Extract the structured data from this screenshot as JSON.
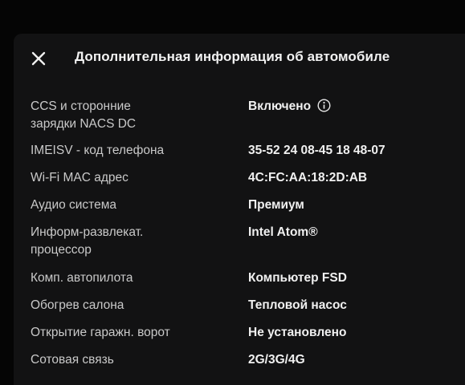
{
  "header": {
    "title": "Дополнительная информация об автомобиле",
    "close_icon": "close-icon"
  },
  "rows": [
    {
      "label_line1": "CCS и сторонние",
      "label_line2": "зарядки NACS DC",
      "value": "Включено",
      "icon": "info-icon"
    },
    {
      "label": "IMEISV - код телефона",
      "value": "35-52 24 08-45 18 48-07"
    },
    {
      "label": "Wi-Fi MAC адрес",
      "value": "4C:FC:AA:18:2D:AB"
    },
    {
      "label": "Аудио система",
      "value": "Премиум"
    },
    {
      "label_line1": "Информ-развлекат.",
      "label_line2": "процессор",
      "value": "Intel Atom®"
    },
    {
      "label": "Комп. автопилота",
      "value": "Компьютер FSD"
    },
    {
      "label": "Обогрев салона",
      "value": "Тепловой насос"
    },
    {
      "label": "Открытие гаражн. ворот",
      "value": "Не установлено"
    },
    {
      "label": "Сотовая связь",
      "value": "2G/3G/4G"
    }
  ]
}
